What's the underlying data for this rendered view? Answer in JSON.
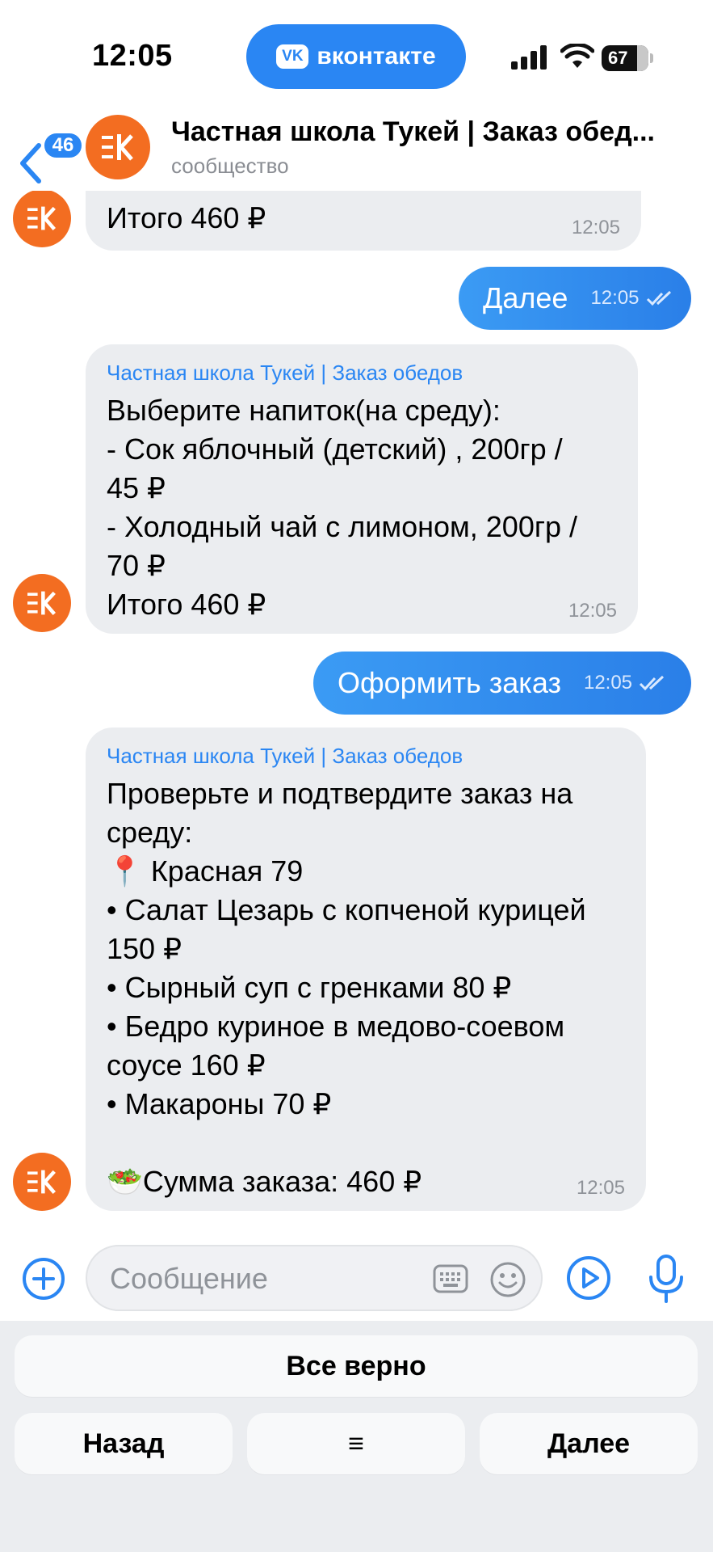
{
  "status_bar": {
    "time": "12:05",
    "app_pill": "вконтакте",
    "vk_logo": "VK",
    "battery": "67"
  },
  "header": {
    "back_count": "46",
    "title": "Частная школа Тукей | Заказ обед...",
    "subtitle": "сообщество"
  },
  "messages": [
    {
      "type": "in",
      "sender": "",
      "lines": [
        "Итого 460 ₽"
      ],
      "time": "12:05"
    },
    {
      "type": "out",
      "text": "Далее",
      "time": "12:05"
    },
    {
      "type": "in",
      "sender": "Частная школа Тукей | Заказ обедов",
      "lines": [
        "Выберите напиток(на среду):",
        "- Сок яблочный (детский) , 200гр /",
        "45 ₽",
        "- Холодный чай с лимоном, 200гр /",
        "70 ₽",
        "Итого 460 ₽"
      ],
      "time": "12:05"
    },
    {
      "type": "out",
      "text": "Оформить заказ",
      "time": "12:05"
    },
    {
      "type": "in",
      "sender": "Частная школа Тукей | Заказ обедов",
      "lines": [
        "Проверьте и подтвердите заказ на",
        "среду:",
        "📍 Красная 79",
        "• Салат Цезарь с копченой курицей",
        "150 ₽",
        "• Сырный суп с гренками 80 ₽",
        "• Бедро куриное в медово-соевом",
        "соусе 160 ₽",
        "• Макароны 70 ₽",
        "",
        "🥗Сумма заказа: 460 ₽"
      ],
      "time": "12:05"
    }
  ],
  "input": {
    "placeholder": "Сообщение"
  },
  "keyboard": {
    "confirm": "Все верно",
    "back": "Назад",
    "menu": "≡",
    "next": "Далее"
  },
  "colors": {
    "accent": "#2a86f3",
    "brand_orange": "#f36d21",
    "bubble_in": "#ebedf0"
  },
  "icons": [
    "back-icon",
    "plus-icon",
    "keyboard-icon",
    "smile-icon",
    "play-icon",
    "mic-icon",
    "double-check-icon"
  ]
}
